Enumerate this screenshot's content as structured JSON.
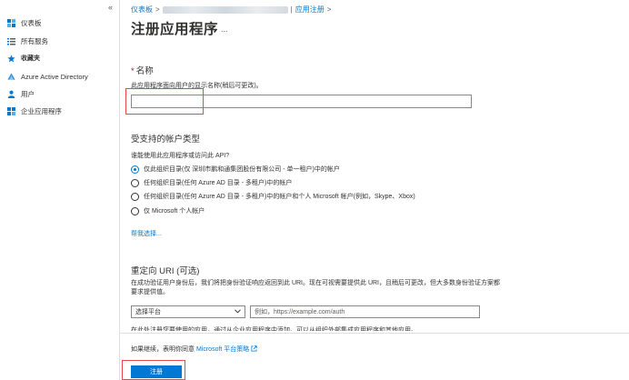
{
  "sidebar": {
    "collapse_glyph": "«",
    "items": [
      {
        "label": "仪表板",
        "icon": "dashboard-icon"
      },
      {
        "label": "所有服务",
        "icon": "list-icon"
      },
      {
        "label": "收藏夹",
        "icon": "star-icon"
      },
      {
        "label": "Azure Active Directory",
        "icon": "azure-ad-icon"
      },
      {
        "label": "用户",
        "icon": "user-icon"
      },
      {
        "label": "企业应用程序",
        "icon": "enterprise-apps-icon"
      }
    ]
  },
  "breadcrumb": {
    "home": "仪表板",
    "current": "应用注册",
    "separator": ">",
    "divider": "|"
  },
  "page": {
    "title": "注册应用程序",
    "more": "..."
  },
  "name_section": {
    "required_mark": "*",
    "label": "名称",
    "help": "此应用程序面向用户的显示名称(稍后可更改)。",
    "value": ""
  },
  "account_section": {
    "label": "受支持的帐户类型",
    "question": "谁能使用此应用程序或访问此 API?",
    "options": [
      {
        "label": "仅此组织目录(仅 深圳市鹏和通集团股份有限公司 - 单一租户)中的帐户",
        "selected": true
      },
      {
        "label": "任何组织目录(任何 Azure AD 目录 - 多租户)中的帐户",
        "selected": false
      },
      {
        "label": "任何组织目录(任何 Azure AD 目录 - 多租户)中的帐户和个人 Microsoft 帐户(例如，Skype、Xbox)",
        "selected": false
      },
      {
        "label": "仅 Microsoft 个人帐户",
        "selected": false
      }
    ],
    "help_link": "帮我选择..."
  },
  "redirect_section": {
    "label": "重定向 URI (可选)",
    "desc": "在成功验证用户身份后，我们将把身份验证响应返回到此 URI。现在可视需要提供此 URI，且稍后可更改，但大多数身份验证方案都要求提供值。",
    "platform_placeholder": "选择平台",
    "uri_placeholder": "例如，https://example.com/auth",
    "cut_text": "在此处注册您要使用的应用，通过从企业应用程序中添加。可以从组织外部集成应用程序和其他应用。"
  },
  "footer": {
    "policy_prefix": "如果继续，表明你同意 ",
    "policy_link": "Microsoft 平台策略",
    "register_label": "注册"
  },
  "colors": {
    "accent": "#0078d4",
    "highlight_box": "#e8484d"
  }
}
